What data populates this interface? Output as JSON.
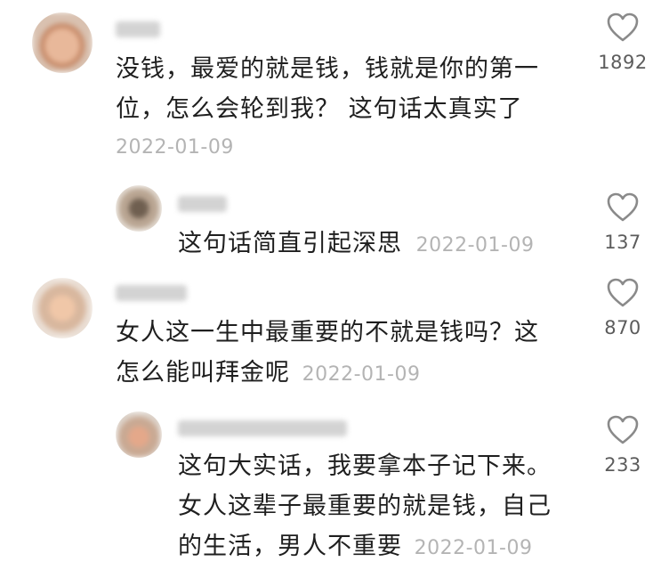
{
  "comments": [
    {
      "line1": "没钱，最爱的就是钱，钱就是你的第一",
      "line2": "位，怎么会轮到我？  这句话太真实了",
      "date": "2022-01-09",
      "likes": "1892"
    },
    {
      "line1": "这句话简直引起深思",
      "date": "2022-01-09",
      "likes": "137"
    },
    {
      "line1": "女人这一生中最重要的不就是钱吗？这",
      "line2": "怎么能叫拜金呢",
      "date": "2022-01-09",
      "likes": "870"
    },
    {
      "line1": "这句大实话，我要拿本子记下来。",
      "line2": "女人这辈子最重要的就是钱，自己",
      "line3": "的生活，男人不重要",
      "date": "2022-01-09",
      "likes": "233"
    }
  ],
  "icons": {
    "like": "heart-outline-icon"
  },
  "colors": {
    "text": "#1f1f1f",
    "date": "#b4b4b4",
    "count": "#5c5c5c",
    "icon": "#8a8a8a"
  }
}
